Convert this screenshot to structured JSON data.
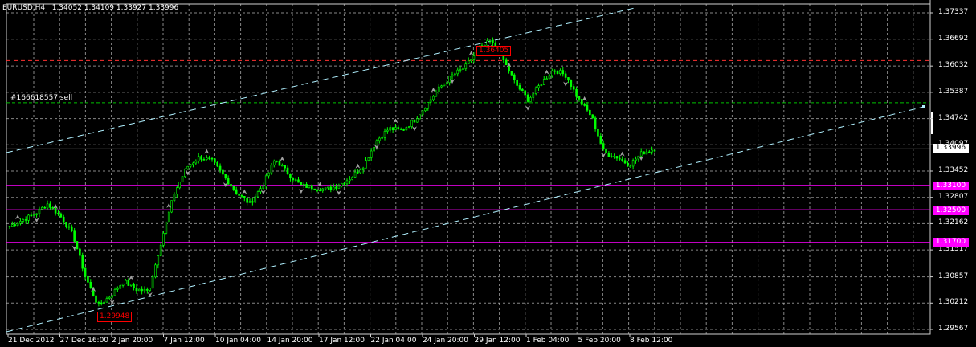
{
  "header": {
    "symbol_timeframe": "EURUSD,H4",
    "open": "1.34052",
    "high": "1.34109",
    "low": "1.33927",
    "close": "1.33996"
  },
  "order_label": "#166618557 sell",
  "price_axis": [
    "1.37337",
    "1.36692",
    "1.36032",
    "1.35387",
    "1.34742",
    "1.34097",
    "1.33452",
    "1.32807",
    "1.32162",
    "1.31517",
    "1.30857",
    "1.30212",
    "1.29567"
  ],
  "time_axis": [
    "21 Dec 2012",
    "27 Dec 16:00",
    "2 Jan 20:00",
    "7 Jan 12:00",
    "10 Jan 04:00",
    "14 Jan 20:00",
    "17 Jan 12:00",
    "22 Jan 04:00",
    "24 Jan 20:00",
    "29 Jan 12:00",
    "1 Feb 04:00",
    "5 Feb 20:00",
    "8 Feb 12:00"
  ],
  "current_price": "1.33996",
  "horizontal_levels": [
    {
      "price": "1.33100",
      "color": "#ff00ff"
    },
    {
      "price": "1.32500",
      "color": "#ff00ff"
    },
    {
      "price": "1.31700",
      "color": "#ff00ff"
    }
  ],
  "price_labels": {
    "high_label": "1.36405",
    "low_label": "1.29948"
  },
  "colors": {
    "background": "#000000",
    "grid": "#c0c0c0",
    "candles": "#00ff00",
    "channel": "#b0f0ff",
    "resistance": "#ff3030",
    "order_line": "#00c000",
    "support_lines": "#ff00ff",
    "fractals": "#a0a0a0"
  },
  "chart_data": {
    "type": "line",
    "title": "EURUSD,H4",
    "x_categories": [
      "21 Dec 2012",
      "27 Dec 16:00",
      "2 Jan 20:00",
      "7 Jan 12:00",
      "10 Jan 04:00",
      "14 Jan 20:00",
      "17 Jan 12:00",
      "22 Jan 04:00",
      "24 Jan 20:00",
      "29 Jan 12:00",
      "1 Feb 04:00",
      "5 Feb 20:00",
      "8 Feb 12:00"
    ],
    "series": [
      {
        "values": [
          1.321,
          1.3225,
          1.324,
          1.3265,
          1.3235,
          1.319,
          1.3085,
          1.3015,
          1.304,
          1.3075,
          1.3055,
          1.305,
          1.3175,
          1.329,
          1.3355,
          1.338,
          1.337,
          1.333,
          1.329,
          1.3265,
          1.331,
          1.3375,
          1.334,
          1.331,
          1.3305,
          1.33,
          1.331,
          1.333,
          1.336,
          1.342,
          1.345,
          1.3445,
          1.347,
          1.351,
          1.355,
          1.358,
          1.36,
          1.364,
          1.3665,
          1.362,
          1.356,
          1.352,
          1.356,
          1.3595,
          1.358,
          1.352,
          1.348,
          1.339,
          1.338,
          1.336,
          1.339,
          1.34
        ]
      }
    ],
    "ylim": [
      1.29567,
      1.37337
    ],
    "levels": [
      1.331,
      1.325,
      1.317,
      1.36165,
      1.3513
    ],
    "annotations": [
      "1.36405",
      "1.29948"
    ],
    "grid": true,
    "legend": "none"
  }
}
